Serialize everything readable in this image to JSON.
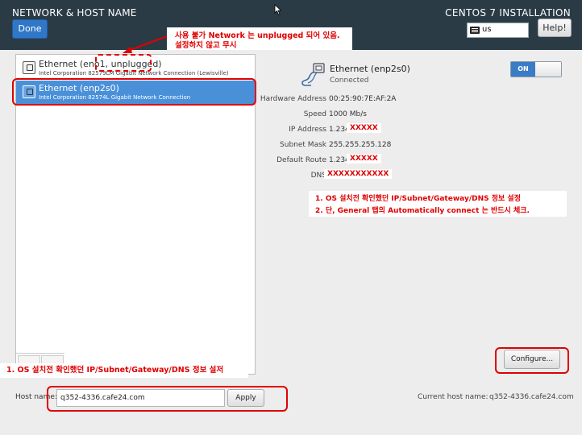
{
  "header": {
    "title": "NETWORK & HOST NAME",
    "done_label": "Done",
    "installation_title": "CENTOS 7 INSTALLATION",
    "keyboard_layout": "us",
    "help_label": "Help!"
  },
  "annotations": {
    "top_line1": "사용 불가 Network 는 unplugged 되어 있음.",
    "top_line2": "설정하지 않고 무시",
    "list_item1": "1.   OS 설치전 확인했던 IP/Subnet/Gateway/DNS 정보 설정",
    "list_item2": "2.   단, General 탭의 Automatically connect 는 반드시 체크.",
    "bottom": "1. OS 설치전 확인했던 IP/Subnet/Gateway/DNS 정보 설저"
  },
  "network_list": {
    "items": [
      {
        "name": "Ethernet (eno1, unplugged)",
        "description": "Intel Corporation 82579LM Gigabit Network Connection (Lewisville)"
      },
      {
        "name": "Ethernet (enp2s0)",
        "description": "Intel Corporation 82574L Gigabit Network Connection"
      }
    ]
  },
  "device": {
    "name": "Ethernet (enp2s0)",
    "status": "Connected",
    "toggle_label": "ON",
    "details": [
      {
        "key": "Hardware Address",
        "value": "00:25:90:7E:AF:2A"
      },
      {
        "key": "Speed",
        "value": "1000 Mb/s"
      },
      {
        "key": "IP Address",
        "value": "1.234",
        "mask": "XXXXX"
      },
      {
        "key": "Subnet Mask",
        "value": "255.255.255.128"
      },
      {
        "key": "Default Route",
        "value": "1.234",
        "mask": "XXXXX"
      },
      {
        "key": "DNS",
        "value": "",
        "mask": "XXXXXXXXXXX"
      }
    ],
    "configure_label": "Configure..."
  },
  "hostname": {
    "label": "Host name:",
    "value": "q352-4336.cafe24.com",
    "apply_label": "Apply",
    "current_label": "Current host name:",
    "current_value": "q352-4336.cafe24.com"
  },
  "colors": {
    "header_bg": "#2b3b46",
    "selection": "#4a90d9",
    "annotation_red": "#e00000",
    "toggle_on": "#3a7cc5"
  }
}
